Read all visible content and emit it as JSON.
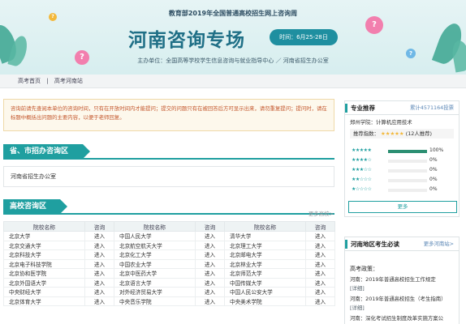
{
  "banner": {
    "top_line": "教育部2019年全国普通高校招生网上咨询周",
    "title": "河南咨询专场",
    "time": "时间：6月25-28日",
    "sponsor": "主办单位：全国高等学校学生信息咨询与就业指导中心 ／ 河南省招生办公室",
    "question_mark": "?",
    "colors": {
      "accent": "#1f9fa0",
      "title": "#1f6f86",
      "bubble_pink": "#f27fae",
      "bubble_blue": "#6fb8e6",
      "bubble_yellow": "#f3b83a",
      "leaf": "#3aa58f"
    }
  },
  "breadcrumb": {
    "home": "高考首页",
    "sep": "|",
    "current": "高考河南站"
  },
  "notice": {
    "text": "咨询前请先查阅本单位的咨询时间，只有在开放时间内才能提问；提交的问题只有在被回答后方可显示出来，请勿重复提问；提问时，请在标题中概括出问题的主要内容，以便于老师回复。"
  },
  "provincial": {
    "heading": "省、市招办咨询区",
    "office": "河南省招生办公室"
  },
  "colleges": {
    "heading": "高校咨询区",
    "more": "更多高校>",
    "columns": [
      "院校名称",
      "咨询",
      "院校名称",
      "咨询",
      "院校名称",
      "咨询"
    ],
    "rows": [
      [
        "北京大学",
        "进入",
        "中国人民大学",
        "进入",
        "清华大学",
        "进入"
      ],
      [
        "北京交通大学",
        "进入",
        "北京航空航天大学",
        "进入",
        "北京理工大学",
        "进入"
      ],
      [
        "北京科技大学",
        "进入",
        "北京化工大学",
        "进入",
        "北京邮电大学",
        "进入"
      ],
      [
        "北京电子科技学院",
        "进入",
        "中国农业大学",
        "进入",
        "北京林业大学",
        "进入"
      ],
      [
        "北京协和医学院",
        "进入",
        "北京中医药大学",
        "进入",
        "北京师范大学",
        "进入"
      ],
      [
        "北京外国语大学",
        "进入",
        "北京语言大学",
        "进入",
        "中国传媒大学",
        "进入"
      ],
      [
        "中央财经大学",
        "进入",
        "对外经济贸易大学",
        "进入",
        "中国人民公安大学",
        "进入"
      ],
      [
        "北京体育大学",
        "进入",
        "中央音乐学院",
        "进入",
        "中央美术学院",
        "进入"
      ]
    ]
  },
  "specialty": {
    "heading": "专业推荐",
    "count": "累计4571164投票",
    "spec_line": "郑州学院：计算机应用技术",
    "score_label": "推荐指数：",
    "score_stars": "★★★★★",
    "score_count": "(12人推荐)",
    "ratings": [
      {
        "stars": "★★★★★",
        "pct": "100%",
        "value": 1.0
      },
      {
        "stars": "★★★★☆",
        "pct": "0%",
        "value": 0
      },
      {
        "stars": "★★★☆☆",
        "pct": "0%",
        "value": 0
      },
      {
        "stars": "★★☆☆☆",
        "pct": "0%",
        "value": 0
      },
      {
        "stars": "★☆☆☆☆",
        "pct": "0%",
        "value": 0
      }
    ],
    "more": "更多"
  },
  "must_read": {
    "heading": "河南地区考生必读",
    "more": "更多河南站>",
    "policy_title": "高考政策：",
    "items": [
      {
        "text": "河南：2019年普通高校招生工作规定",
        "detail": "[详细]"
      },
      {
        "text": "河南：2019年普通高校招生（考生指南）",
        "detail": "[详细]"
      },
      {
        "text": "河南：深化考试招生制度改革实施方案公",
        "detail": ""
      }
    ]
  }
}
